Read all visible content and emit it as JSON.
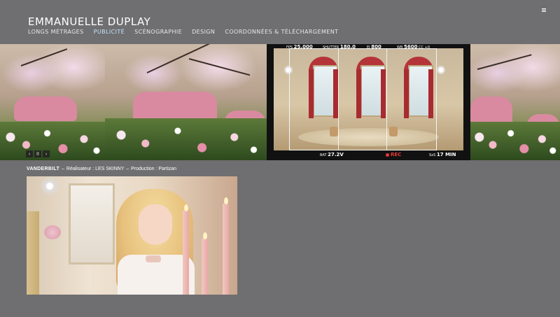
{
  "header": {
    "title": "EMMANUELLE DUPLAY",
    "menu_icon": "hamburger-icon"
  },
  "nav": {
    "items": [
      {
        "label": "LONGS MÉTRAGES",
        "active": false
      },
      {
        "label": "PUBLICITÉ",
        "active": true
      },
      {
        "label": "SCÉNOGRAPHIE",
        "active": false
      },
      {
        "label": "DESIGN",
        "active": false
      },
      {
        "label": "COORDONNÉES & TÉLÉCHARGEMENT",
        "active": false
      }
    ]
  },
  "gallery": {
    "controls": {
      "prev": "‹",
      "pause": "II",
      "next": "›"
    },
    "camera_hud": {
      "fps_label": "FPS",
      "fps_value": "25.000",
      "shutter_label": "SHUTTER",
      "shutter_value": "180.0",
      "ei_label": "EI",
      "ei_value": "800",
      "wb_label": "WB",
      "wb_value": "5600",
      "cc_label": "CC",
      "cc_value": "+0",
      "bat_label": "BAT",
      "bat_value": "27.2V",
      "rec_label": "REC",
      "sxs_label": "SxS",
      "sxs_value": "17 MIN"
    }
  },
  "caption": {
    "title": "VANDERBILT",
    "sep1": "–",
    "director_label": "Réalisateur :",
    "director_value": "LES SKINNY",
    "sep2": "–",
    "production_label": "Production :",
    "production_value": "Partizan"
  },
  "colors": {
    "background": "#6f6e71",
    "nav_active": "#bfe4f7",
    "rec": "#e53935"
  }
}
